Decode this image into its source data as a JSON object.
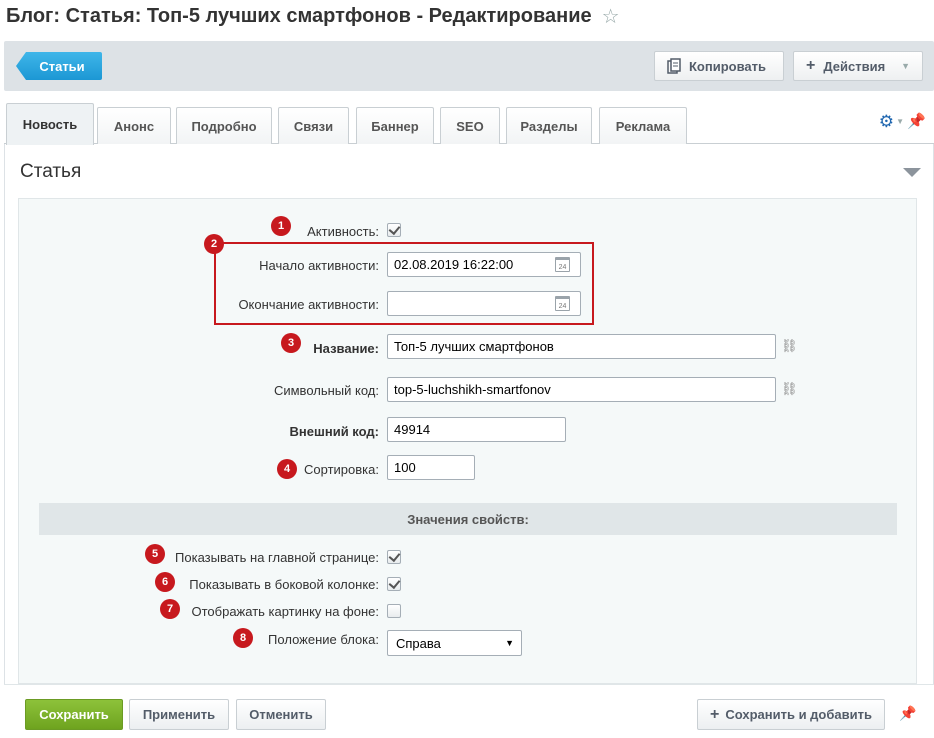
{
  "header": {
    "title": "Блог: Статья: Топ-5 лучших смартфонов - Редактирование",
    "favorite_icon": "star-icon"
  },
  "toolbar": {
    "back_label": "Статьи",
    "copy_label": "Копировать",
    "actions_label": "Действия"
  },
  "tabs": [
    {
      "label": "Новость",
      "active": true
    },
    {
      "label": "Анонс",
      "active": false
    },
    {
      "label": "Подробно",
      "active": false
    },
    {
      "label": "Связи",
      "active": false
    },
    {
      "label": "Баннер",
      "active": false
    },
    {
      "label": "SEO",
      "active": false
    },
    {
      "label": "Разделы",
      "active": false
    },
    {
      "label": "Реклама",
      "active": false
    }
  ],
  "section": {
    "title": "Статья"
  },
  "form": {
    "active": {
      "label": "Активность:",
      "checked": true,
      "badge": "1"
    },
    "active_from": {
      "label": "Начало активности:",
      "value": "02.08.2019 16:22:00",
      "badge": "2"
    },
    "active_to": {
      "label": "Окончание активности:",
      "value": ""
    },
    "name": {
      "label": "Название:",
      "value": "Топ-5 лучших смартфонов",
      "badge": "3"
    },
    "code": {
      "label": "Символьный код:",
      "value": "top-5-luchshikh-smartfonov"
    },
    "xml_id": {
      "label": "Внешний код:",
      "value": "49914"
    },
    "sort": {
      "label": "Сортировка:",
      "value": "100",
      "badge": "4"
    }
  },
  "properties": {
    "header": "Значения свойств:",
    "show_main": {
      "label": "Показывать на главной странице:",
      "checked": true,
      "badge": "5"
    },
    "show_side": {
      "label": "Показывать в боковой колонке:",
      "checked": true,
      "badge": "6"
    },
    "bg_image": {
      "label": "Отображать картинку на фоне:",
      "checked": false,
      "badge": "7"
    },
    "position": {
      "label": "Положение блока:",
      "value": "Справа",
      "badge": "8"
    }
  },
  "footer": {
    "save_label": "Сохранить",
    "apply_label": "Применить",
    "cancel_label": "Отменить",
    "save_add_label": "Сохранить и добавить"
  },
  "colors": {
    "accent_blue": "#1c97d4",
    "save_green": "#6ea31f",
    "badge_red": "#c7191e"
  }
}
